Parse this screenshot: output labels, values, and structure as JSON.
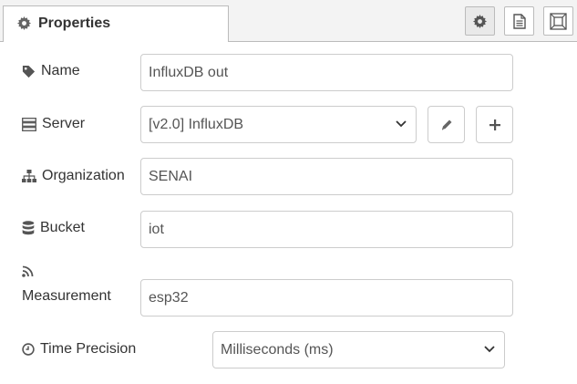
{
  "tab": {
    "title": "Properties",
    "icon": "gear-icon"
  },
  "toolbar": {
    "buttons": [
      "gear-icon",
      "description-icon",
      "appearance-icon"
    ]
  },
  "form": {
    "name": {
      "label": "Name",
      "icon": "tag-icon",
      "value": "InfluxDB out"
    },
    "server": {
      "label": "Server",
      "icon": "server-icon",
      "selected": "[v2.0] InfluxDB",
      "edit_icon": "pencil-icon",
      "add_icon": "plus-icon"
    },
    "organization": {
      "label": "Organization",
      "icon": "sitemap-icon",
      "value": "SENAI"
    },
    "bucket": {
      "label": "Bucket",
      "icon": "database-icon",
      "value": "iot"
    },
    "measurement": {
      "label": "Measurement",
      "icon": "rss-icon",
      "value": "esp32"
    },
    "time_precision": {
      "label": "Time Precision",
      "icon": "clock-icon",
      "selected": "Milliseconds (ms)"
    }
  }
}
